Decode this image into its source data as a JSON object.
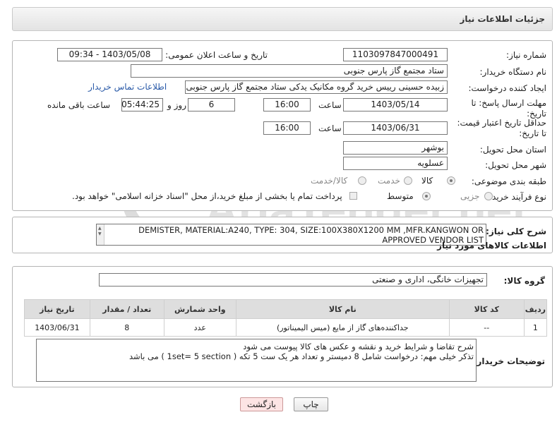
{
  "header": {
    "title": "جزئیات اطلاعات نیاز"
  },
  "form": {
    "need_number_label": "شماره نیاز:",
    "need_number": "1103097847000491",
    "announce_label": "تاریخ و ساعت اعلان عمومی:",
    "announce_value": "1403/05/08 - 09:34",
    "buyer_org_label": "نام دستگاه خریدار:",
    "buyer_org": "ستاد مجتمع گاز پارس جنوبی",
    "creator_label": "ایجاد کننده درخواست:",
    "creator": "زبیده حسینی رییس خرید گروه مکانیک یدکی ستاد مجتمع گاز پارس جنوبی",
    "contact_link": "اطلاعات تماس خریدار",
    "deadline_label": "مهلت ارسال پاسخ: تا تاریخ:",
    "deadline_date": "1403/05/14",
    "time_label": "ساعت",
    "deadline_time": "16:00",
    "days_value": "6",
    "days_label": "روز و",
    "remaining_time": "05:44:25",
    "remaining_label": "ساعت باقی مانده",
    "validity_label": "حداقل تاریخ اعتبار قیمت: تا تاریخ:",
    "validity_date": "1403/06/31",
    "validity_time": "16:00",
    "province_label": "استان محل تحویل:",
    "province": "بوشهر",
    "city_label": "شهر محل تحویل:",
    "city": "عسلویه",
    "category_label": "طبقه بندی موضوعی:",
    "category_options": [
      "کالا",
      "خدمت",
      "کالا/خدمت"
    ],
    "process_label": "نوع فرآیند خرید :",
    "process_options": [
      "جزیی",
      "متوسط"
    ],
    "payment_note": "پرداخت تمام یا بخشی از مبلغ خرید،از محل \"اسناد خزانه اسلامی\" خواهد بود."
  },
  "description": {
    "label": "شرح کلی نیاز:",
    "text": "DEMISTER, MATERIAL:A240, TYPE: 304, SIZE:100X380X1200 MM ,MFR.KANGWON OR APPROVED VENDOR LIST"
  },
  "goods": {
    "section_title": "اطلاعات کالاهای مورد نیاز",
    "group_label": "گروه کالا:",
    "group_value": "تجهیزات خانگی، اداری و صنعتی",
    "columns": [
      "ردیف",
      "کد کالا",
      "نام کالا",
      "واحد شمارش",
      "تعداد / مقدار",
      "تاریخ نیاز"
    ],
    "rows": [
      {
        "row": "1",
        "code": "--",
        "name": "جداکننده‌های گاز از مایع (میس الیمیناتور)",
        "unit": "عدد",
        "qty": "8",
        "date": "1403/06/31"
      }
    ]
  },
  "buyer_notes": {
    "label": "توضیحات خریدار:",
    "line1": "شرح تقاضا و شرایط خرید و نقشه و عکس های کالا پیوست می شود",
    "line2": "تذکر خیلی مهم: درخواست شامل  8 دمیستر و تعداد هر یک ست 5 تکه (   1set= 5 section ) می باشد"
  },
  "buttons": {
    "print": "چاپ",
    "back": "بازگشت"
  },
  "colors": {
    "link": "#2a5aa8",
    "back_bg": "#fde4e4",
    "watermark": "#d9d9d9"
  }
}
